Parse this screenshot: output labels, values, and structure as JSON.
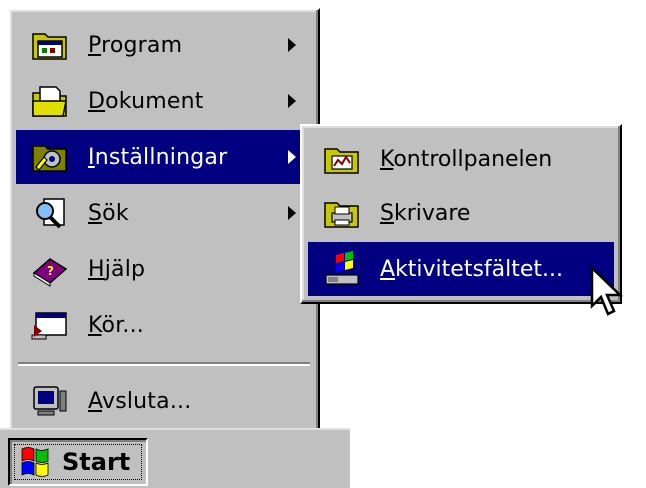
{
  "start_menu": {
    "items": [
      {
        "pre": "",
        "ul": "P",
        "post": "rogram",
        "icon": "folder-programs-icon",
        "has_submenu": true
      },
      {
        "pre": "",
        "ul": "D",
        "post": "okument",
        "icon": "folder-documents-icon",
        "has_submenu": true
      },
      {
        "pre": "",
        "ul": "I",
        "post": "nställningar",
        "icon": "settings-icon",
        "has_submenu": true,
        "active": true
      },
      {
        "pre": "",
        "ul": "S",
        "post": "ök",
        "icon": "search-magnifier-icon",
        "has_submenu": true
      },
      {
        "pre": "",
        "ul": "H",
        "post": "jälp",
        "icon": "help-book-icon",
        "has_submenu": false
      },
      {
        "pre": "",
        "ul": "K",
        "post": "ör...",
        "icon": "run-window-icon",
        "has_submenu": false
      },
      {
        "pre": "",
        "ul": "A",
        "post": "vsluta...",
        "icon": "shutdown-computer-icon",
        "has_submenu": false
      }
    ]
  },
  "submenu": {
    "items": [
      {
        "ul": "K",
        "post": "ontrollpanelen",
        "icon": "control-panel-folder-icon"
      },
      {
        "ul": "S",
        "post": "krivare",
        "icon": "printers-folder-icon"
      },
      {
        "ul": "A",
        "post": "ktivitetsfältet...",
        "icon": "taskbar-icon",
        "active": true
      }
    ]
  },
  "taskbar": {
    "start_label": "Start"
  },
  "colors": {
    "face": "#c0c0c0",
    "highlight": "#000080",
    "highlight_text": "#ffffff",
    "text": "#000000"
  }
}
